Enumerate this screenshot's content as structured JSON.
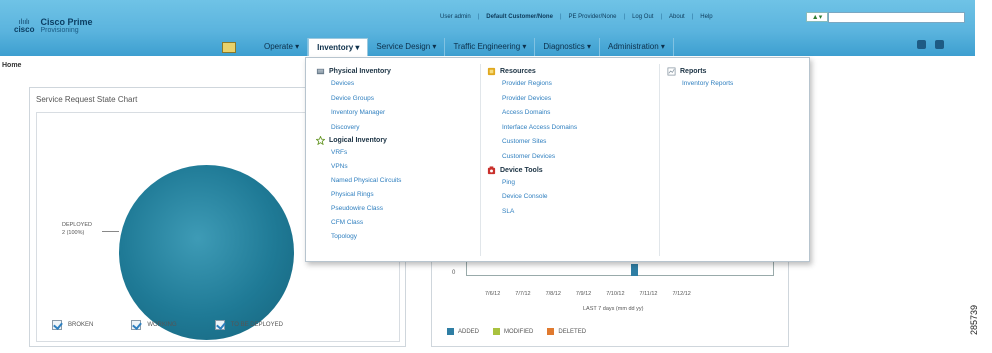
{
  "app": {
    "brand_mark": "cisco",
    "title": "Cisco Prime",
    "subtitle": "Provisioning"
  },
  "utility_links": [
    "User admin",
    "Default Customer/None",
    "PE Provider/None",
    "Log Out",
    "About",
    "Help"
  ],
  "nav": {
    "items": [
      {
        "label": "Operate ▾",
        "active": false
      },
      {
        "label": "Inventory ▾",
        "active": true
      },
      {
        "label": "Service Design ▾",
        "active": false
      },
      {
        "label": "Traffic Engineering ▾",
        "active": false
      },
      {
        "label": "Diagnostics ▾",
        "active": false
      },
      {
        "label": "Administration ▾",
        "active": false
      }
    ]
  },
  "breadcrumb": "Home",
  "chart_panel": {
    "title": "Service Request State Chart"
  },
  "chart_data": [
    {
      "type": "pie",
      "title": "Service Request State Chart",
      "slices": [
        {
          "label": "DEPLOYED",
          "value": 2,
          "percent": 100
        }
      ],
      "slice_label": [
        "DEPLOYED",
        "2 (100%)"
      ],
      "legend": [
        "BROKEN",
        "WORKING",
        "TO BE DEPLOYED"
      ],
      "color": "#1f7a96"
    },
    {
      "type": "bar",
      "x": [
        "7/6/12",
        "7/7/12",
        "7/8/12",
        "7/9/12",
        "7/10/12",
        "7/11/12",
        "7/12/12"
      ],
      "series": [
        {
          "name": "ADDED",
          "color": "#2f7ea4"
        },
        {
          "name": "MODIFIED",
          "color": "#a9c23f"
        },
        {
          "name": "DELETED",
          "color": "#e07a2f"
        }
      ],
      "y_tick": "0",
      "xlabel": "LAST 7 days (mm dd yy)"
    }
  ],
  "dropdown": {
    "physical": {
      "heading": "Physical Inventory",
      "items": [
        "Devices",
        "Device Groups",
        "Inventory Manager",
        "Discovery"
      ]
    },
    "logical": {
      "heading": "Logical Inventory",
      "items": [
        "VRFs",
        "VPNs",
        "Named Physical Circuits",
        "Physical Rings",
        "Pseudowire Class",
        "CFM Class",
        "Topology"
      ]
    },
    "resources": {
      "heading": "Resources",
      "items": [
        "Provider Regions",
        "Provider Devices",
        "Access Domains",
        "Interface Access Domains",
        "Customer Sites",
        "Customer Devices"
      ]
    },
    "device_tools": {
      "heading": "Device Tools",
      "items": [
        "Ping",
        "Device Console",
        "SLA"
      ]
    },
    "reports": {
      "heading": "Reports",
      "items": [
        "Inventory Reports"
      ]
    }
  },
  "figure_code": "285739"
}
